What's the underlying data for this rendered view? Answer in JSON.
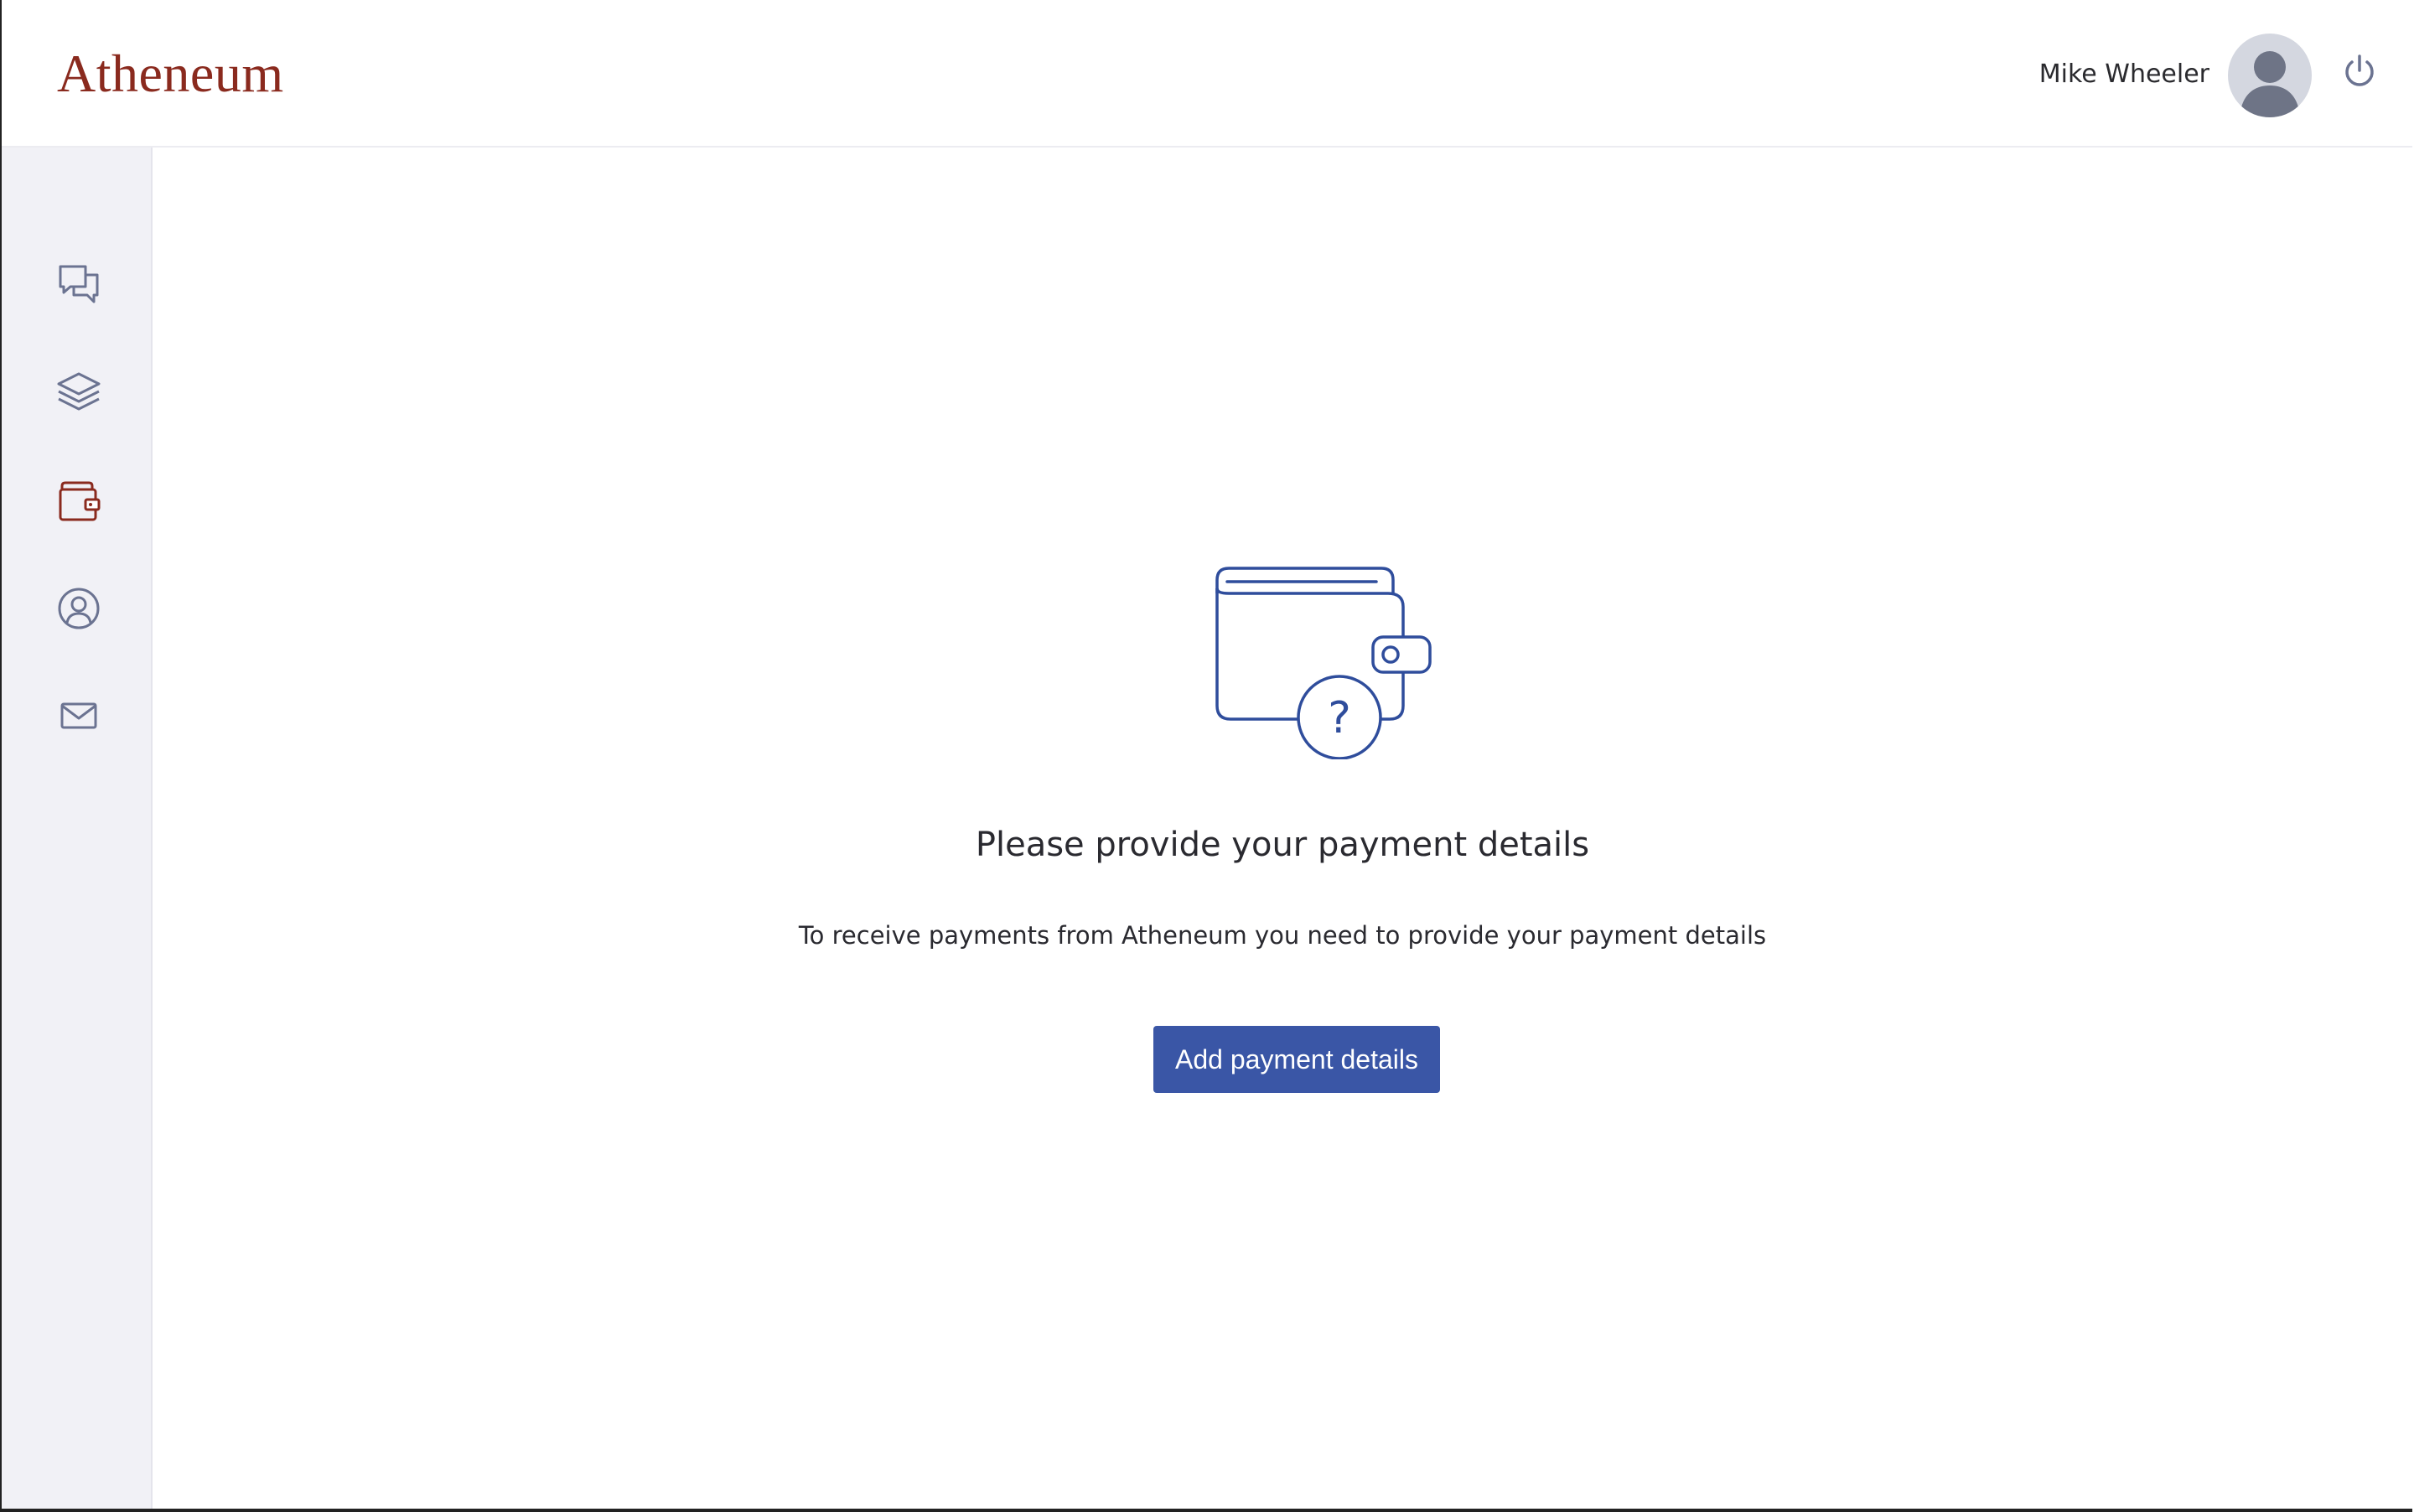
{
  "header": {
    "logo_text": "Atheneum",
    "user_name": "Mike Wheeler",
    "avatar_icon": "user-silhouette-icon",
    "logout_icon": "power-icon"
  },
  "sidebar": {
    "items": [
      {
        "icon": "chat-bubbles-icon",
        "active": false
      },
      {
        "icon": "layers-icon",
        "active": false
      },
      {
        "icon": "wallet-icon",
        "active": true
      },
      {
        "icon": "user-circle-icon",
        "active": false
      },
      {
        "icon": "mail-icon",
        "active": false
      }
    ]
  },
  "main": {
    "illustration_icon": "wallet-question-icon",
    "title": "Please provide your payment details",
    "subtitle": "To receive payments from Atheneum you need to provide your payment details",
    "cta_label": "Add payment details"
  },
  "colors": {
    "brand": "#8a2a1e",
    "accent": "#3a56a6",
    "sidebar_bg": "#f1f1f6",
    "icon_muted": "#6b7391",
    "illustration_stroke": "#2f4d9c"
  }
}
